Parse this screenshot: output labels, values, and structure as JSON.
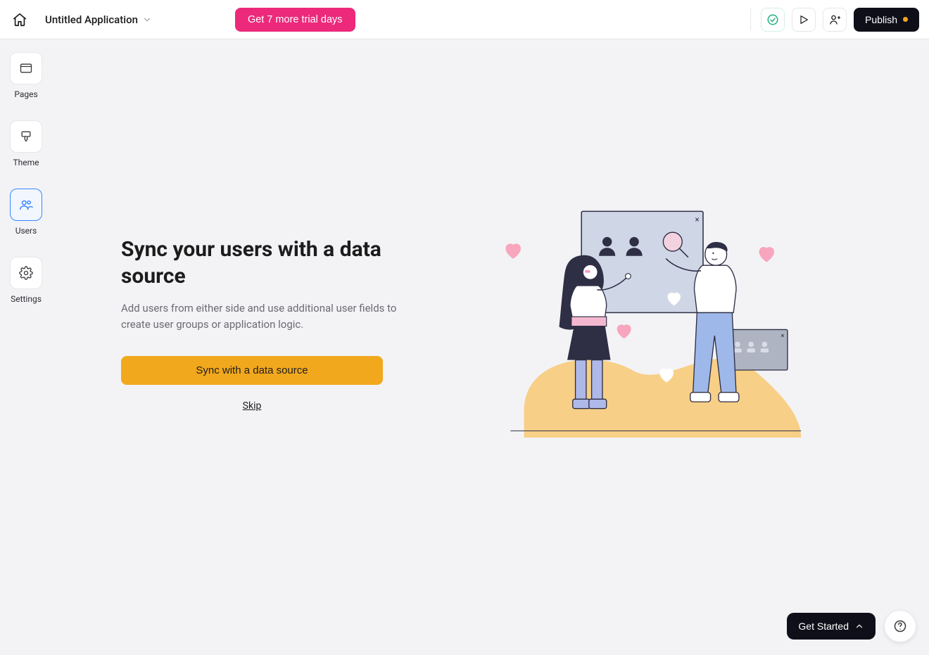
{
  "header": {
    "app_name": "Untitled Application",
    "trial_label": "Get 7 more trial days",
    "publish_label": "Publish"
  },
  "sidebar": {
    "items": [
      {
        "label": "Pages"
      },
      {
        "label": "Theme"
      },
      {
        "label": "Users"
      },
      {
        "label": "Settings"
      }
    ]
  },
  "main": {
    "heading": "Sync your users with a data source",
    "description": "Add users from either side and use additional user fields to create user groups or application logic.",
    "cta_label": "Sync with a data source",
    "skip_label": "Skip"
  },
  "float": {
    "get_started": "Get Started"
  },
  "colors": {
    "accent_pink": "#ec297b",
    "accent_yellow": "#f2a81d",
    "accent_blue": "#3985ff",
    "dark": "#0f0f1a",
    "green": "#22b07d"
  }
}
